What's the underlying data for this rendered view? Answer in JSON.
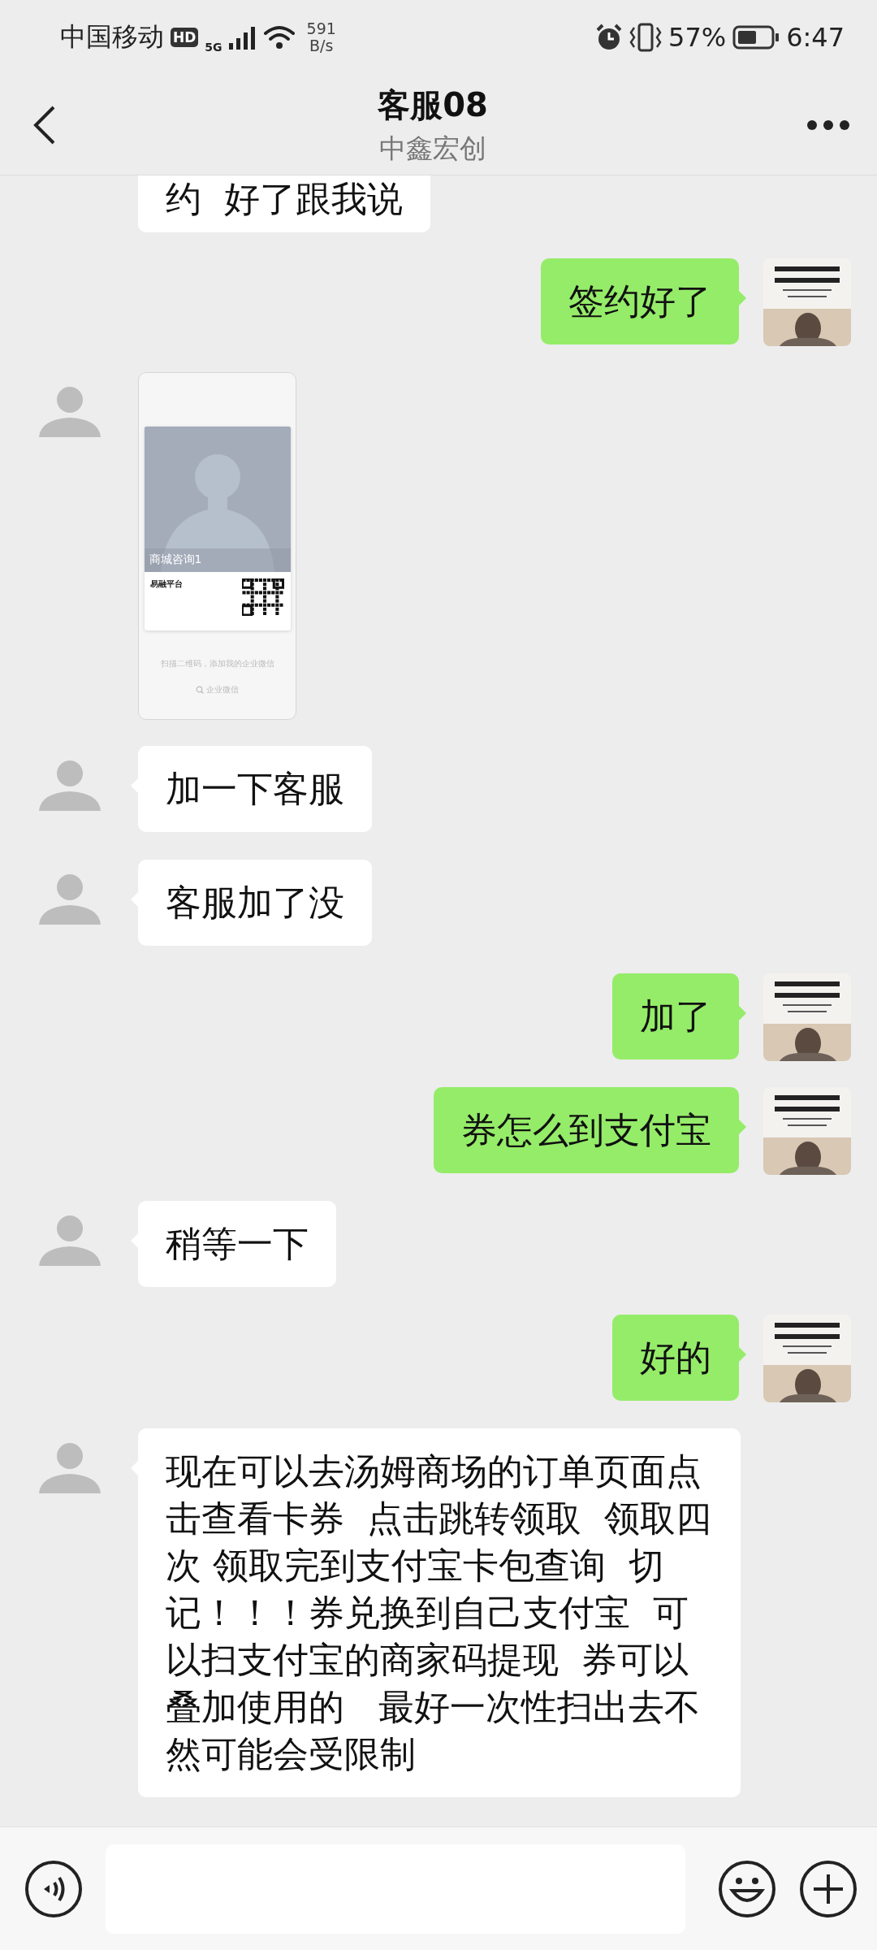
{
  "status_bar": {
    "carrier": "中国移动",
    "hd": "HD",
    "network": "5G",
    "speed_value": "591",
    "speed_unit": "B/s",
    "battery": "57%",
    "time": "6:47"
  },
  "header": {
    "title": "客服08",
    "subtitle": "中鑫宏创"
  },
  "messages": [
    {
      "sent": false,
      "kind": "text",
      "text": "约  好了跟我说",
      "clipped": true
    },
    {
      "sent": true,
      "kind": "text",
      "text": "签约好了",
      "clipped": false
    },
    {
      "sent": false,
      "kind": "card",
      "photo_label": "商城咨询1",
      "name": "易融平台",
      "hint": "扫描二维码，添加我的企业微信",
      "footer": "企业微信"
    },
    {
      "sent": false,
      "kind": "text",
      "text": "加一下客服",
      "clipped": false
    },
    {
      "sent": false,
      "kind": "text",
      "text": "客服加了没",
      "clipped": false
    },
    {
      "sent": true,
      "kind": "text",
      "text": "加了",
      "clipped": false
    },
    {
      "sent": true,
      "kind": "text",
      "text": "券怎么到支付宝",
      "clipped": false
    },
    {
      "sent": false,
      "kind": "text",
      "text": "稍等一下",
      "clipped": false
    },
    {
      "sent": true,
      "kind": "text",
      "text": "好的",
      "clipped": false
    },
    {
      "sent": false,
      "kind": "text",
      "text": "现在可以去汤姆商场的订单页面点击查看卡券  点击跳转领取  领取四次 领取完到支付宝卡包查询  切记！！！券兑换到自己支付宝  可以扫支付宝的商家码提现  券可以叠加使用的   最好一次性扫出去不然可能会受限制",
      "clipped": false
    }
  ]
}
